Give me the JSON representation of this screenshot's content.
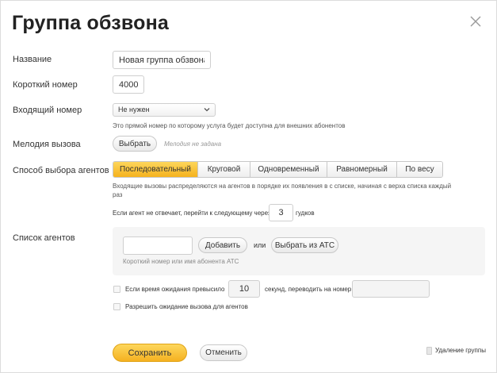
{
  "dialog": {
    "title": "Группа обзвона"
  },
  "form": {
    "name_label": "Название",
    "name_value": "Новая группа обзвона",
    "short_number_label": "Короткий номер",
    "short_number_value": "4000",
    "incoming_label": "Входящий номер",
    "incoming_selected": "Не нужен",
    "incoming_hint": "Это прямой номер по которому услуга будет доступна для внешних абонентов",
    "ringtone_label": "Мелодия вызова",
    "ringtone_button": "Выбрать",
    "ringtone_status": "Мелодия не задана",
    "strategy_label": "Способ выбора агентов",
    "strategy_options": [
      "Последовательный",
      "Круговой",
      "Одновременный",
      "Равномерный",
      "По весу"
    ],
    "strategy_selected_index": 0,
    "strategy_hint_line1": "Входящие вызовы распределяются на агентов в порядке их появления в с списке, начиная с верха списка каждый",
    "strategy_hint_line2": "раз",
    "no_answer_text": "Если агент не отвечает, перейти к следующему через",
    "no_answer_value": "3",
    "no_answer_unit": "гудков",
    "agents_label": "Список агентов",
    "agents_input_value": "",
    "add_button": "Добавить",
    "or_text": "или",
    "pick_from_ats_button": "Выбрать из АТС",
    "agents_hint": "Короткий номер или имя абонента АТС",
    "wait_exceeded_text": "Если время ожидания превысило",
    "wait_seconds_value": "10",
    "wait_redirect_text": "секунд, переводить на номер",
    "wait_redirect_value": "",
    "allow_wait_text": "Разрешить ожидание вызова для агентов"
  },
  "footer": {
    "save_button": "Сохранить",
    "cancel_button": "Отменить",
    "delete_text": "Удаление группы"
  },
  "colors": {
    "accent_yellow": "#f5b21e",
    "text": "#333333"
  }
}
